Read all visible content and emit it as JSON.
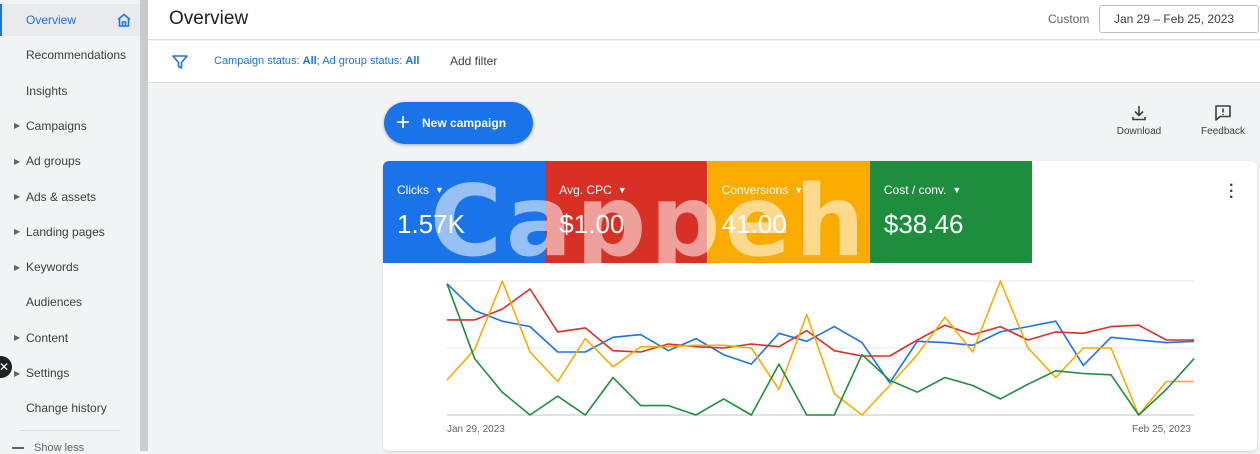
{
  "sidebar": {
    "items": [
      {
        "label": "Overview",
        "active": true,
        "caret": false
      },
      {
        "label": "Recommendations",
        "caret": false
      },
      {
        "label": "Insights",
        "caret": false
      },
      {
        "label": "Campaigns",
        "caret": true
      },
      {
        "label": "Ad groups",
        "caret": true
      },
      {
        "label": "Ads & assets",
        "caret": true
      },
      {
        "label": "Landing pages",
        "caret": true
      },
      {
        "label": "Keywords",
        "caret": true
      },
      {
        "label": "Audiences",
        "caret": false
      },
      {
        "label": "Content",
        "caret": true
      },
      {
        "label": "Settings",
        "caret": true
      },
      {
        "label": "Change history",
        "caret": false
      }
    ],
    "show_less": "Show less"
  },
  "header": {
    "title": "Overview",
    "custom_label": "Custom",
    "date_range": "Jan 29 – Feb 25, 2023"
  },
  "filter": {
    "campaign_status_label": "Campaign status:",
    "campaign_status_value": "All",
    "ad_group_status_label": "Ad group status:",
    "ad_group_status_value": "All",
    "add_filter": "Add filter"
  },
  "actions": {
    "new_campaign": "New campaign",
    "download": "Download",
    "feedback": "Feedback"
  },
  "metrics": [
    {
      "label": "Clicks",
      "value": "1.57K",
      "color": "#1a73e8"
    },
    {
      "label": "Avg. CPC",
      "value": "$1.00",
      "color": "#d93025"
    },
    {
      "label": "Conversions",
      "value": "41.00",
      "color": "#f9ab00"
    },
    {
      "label": "Cost / conv.",
      "value": "$38.46",
      "color": "#1e8e3e"
    }
  ],
  "watermark": "Cappeh",
  "chart_data": {
    "type": "line",
    "x_start": "Jan 29, 2023",
    "x_end": "Feb 25, 2023",
    "x": [
      "Jan 29",
      "Jan 30",
      "Jan 31",
      "Feb 1",
      "Feb 2",
      "Feb 3",
      "Feb 4",
      "Feb 5",
      "Feb 6",
      "Feb 7",
      "Feb 8",
      "Feb 9",
      "Feb 10",
      "Feb 11",
      "Feb 12",
      "Feb 13",
      "Feb 14",
      "Feb 15",
      "Feb 16",
      "Feb 17",
      "Feb 18",
      "Feb 19",
      "Feb 20",
      "Feb 21",
      "Feb 22",
      "Feb 23",
      "Feb 24",
      "Feb 25"
    ],
    "grid": true,
    "series": [
      {
        "color": "#1a73e8",
        "values": [
          0.98,
          0.78,
          0.7,
          0.66,
          0.47,
          0.47,
          0.58,
          0.6,
          0.48,
          0.57,
          0.45,
          0.38,
          0.61,
          0.55,
          0.66,
          0.54,
          0.24,
          0.55,
          0.54,
          0.52,
          0.62,
          0.66,
          0.7,
          0.37,
          0.58,
          0.56,
          0.54,
          0.55
        ]
      },
      {
        "color": "#d93025",
        "values": [
          0.71,
          0.71,
          0.79,
          0.94,
          0.62,
          0.65,
          0.48,
          0.47,
          0.53,
          0.51,
          0.5,
          0.53,
          0.51,
          0.63,
          0.48,
          0.44,
          0.44,
          0.56,
          0.67,
          0.6,
          0.66,
          0.56,
          0.62,
          0.61,
          0.66,
          0.67,
          0.56,
          0.56
        ]
      },
      {
        "color": "#f9ab00",
        "values": [
          0.26,
          0.49,
          1.0,
          0.47,
          0.25,
          0.57,
          0.36,
          0.51,
          0.51,
          0.52,
          0.52,
          0.5,
          0.19,
          0.75,
          0.16,
          0.0,
          0.22,
          0.45,
          0.73,
          0.47,
          1.0,
          0.5,
          0.28,
          0.5,
          0.5,
          0.0,
          0.25,
          0.25
        ]
      },
      {
        "color": "#1e8e3e",
        "values": [
          0.98,
          0.42,
          0.17,
          0.0,
          0.14,
          0.0,
          0.28,
          0.07,
          0.07,
          0.0,
          0.12,
          0.0,
          0.38,
          0.0,
          0.0,
          0.45,
          0.26,
          0.17,
          0.28,
          0.22,
          0.12,
          0.23,
          0.33,
          0.31,
          0.3,
          0.0,
          0.19,
          0.42
        ]
      }
    ]
  }
}
